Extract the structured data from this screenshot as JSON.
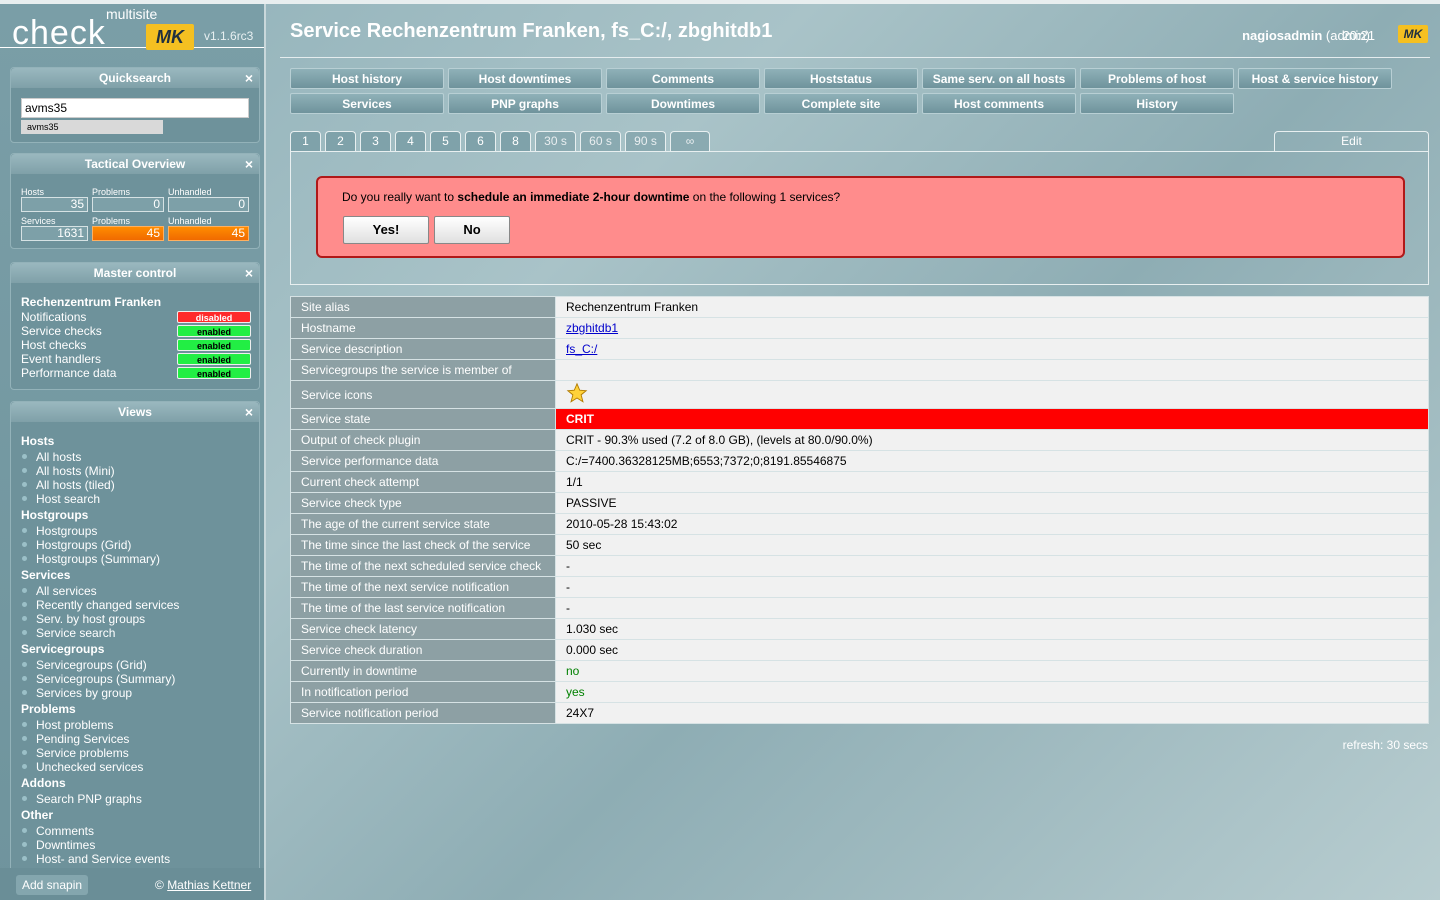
{
  "logo": {
    "multisite": "multisite",
    "check": "check",
    "mk": "MK",
    "version": "v1.1.6rc3"
  },
  "quicksearch": {
    "title": "Quicksearch",
    "value": "avms35",
    "suggestion": "avms35",
    "close": "×"
  },
  "tactical": {
    "title": "Tactical Overview",
    "close": "×",
    "hosts_label": "Hosts",
    "problems_label": "Problems",
    "unhandled_label": "Unhandled",
    "services_label": "Services",
    "hosts": "35",
    "host_problems": "0",
    "host_unhandled": "0",
    "services": "1631",
    "service_problems": "45",
    "service_unhandled": "45"
  },
  "master_control": {
    "title": "Master control",
    "close": "×",
    "site": "Rechenzentrum Franken",
    "rows": [
      {
        "label": "Notifications",
        "state": "disabled"
      },
      {
        "label": "Service checks",
        "state": "enabled"
      },
      {
        "label": "Host checks",
        "state": "enabled"
      },
      {
        "label": "Event handlers",
        "state": "enabled"
      },
      {
        "label": "Performance data",
        "state": "enabled"
      }
    ]
  },
  "views": {
    "title": "Views",
    "close": "×",
    "groups": [
      {
        "name": "Hosts",
        "items": [
          "All hosts",
          "All hosts (Mini)",
          "All hosts (tiled)",
          "Host search"
        ]
      },
      {
        "name": "Hostgroups",
        "items": [
          "Hostgroups",
          "Hostgroups (Grid)",
          "Hostgroups (Summary)"
        ]
      },
      {
        "name": "Services",
        "items": [
          "All services",
          "Recently changed services",
          "Serv. by host groups",
          "Service search"
        ]
      },
      {
        "name": "Servicegroups",
        "items": [
          "Servicegroups (Grid)",
          "Servicegroups (Summary)",
          "Services by group"
        ]
      },
      {
        "name": "Problems",
        "items": [
          "Host problems",
          "Pending Services",
          "Service problems",
          "Unchecked services"
        ]
      },
      {
        "name": "Addons",
        "items": [
          "Search PNP graphs"
        ]
      },
      {
        "name": "Other",
        "items": [
          "Comments",
          "Downtimes",
          "Host- and Service events"
        ]
      }
    ]
  },
  "footer": {
    "add_snapin": "Add snapin",
    "copyright_prefix": "©",
    "author": "Mathias Kettner"
  },
  "header": {
    "title": "Service Rechenzentrum Franken, fs_C:/, zbghitdb1",
    "user": "nagiosadmin",
    "role": "(admin)",
    "time": "20:21",
    "mk": "MK"
  },
  "context_buttons": {
    "row1": [
      "Host history",
      "Host downtimes",
      "Comments",
      "Hoststatus",
      "Same serv. on all hosts",
      "Problems of host",
      "Host & service history"
    ],
    "row2": [
      "Services",
      "PNP graphs",
      "Downtimes",
      "Complete site",
      "Host comments",
      "History"
    ]
  },
  "tabs": [
    "1",
    "2",
    "3",
    "4",
    "5",
    "6",
    "8",
    "30 s",
    "60 s",
    "90 s",
    "∞"
  ],
  "edit_tab": "Edit",
  "confirm": {
    "prefix": "Do you really want to ",
    "bold": "schedule an immediate 2-hour downtime",
    "suffix": " on the following 1 services?",
    "yes": "Yes!",
    "no": "No"
  },
  "info_rows": [
    {
      "label": "Site alias",
      "value": "Rechenzentrum Franken"
    },
    {
      "label": "Hostname",
      "value": "zbghitdb1",
      "link": true
    },
    {
      "label": "Service description",
      "value": "fs_C:/",
      "link": true
    },
    {
      "label": "Servicegroups the service is member of",
      "value": ""
    },
    {
      "label": "Service icons",
      "value": "",
      "icon": "star-icon"
    },
    {
      "label": "Service state",
      "value": "CRIT",
      "state": "crit"
    },
    {
      "label": "Output of check plugin",
      "value": "CRIT - 90.3% used (7.2 of 8.0 GB), (levels at 80.0/90.0%)"
    },
    {
      "label": "Service performance data",
      "value": "C:/=7400.36328125MB;6553;7372;0;8191.85546875"
    },
    {
      "label": "Current check attempt",
      "value": "1/1"
    },
    {
      "label": "Service check type",
      "value": "PASSIVE"
    },
    {
      "label": "The age of the current service state",
      "value": "2010-05-28 15:43:02"
    },
    {
      "label": "The time since the last check of the service",
      "value": "50 sec"
    },
    {
      "label": "The time of the next scheduled service check",
      "value": "-"
    },
    {
      "label": "The time of the next service notification",
      "value": "-"
    },
    {
      "label": "The time of the last service notification",
      "value": "-"
    },
    {
      "label": "Service check latency",
      "value": "1.030 sec"
    },
    {
      "label": "Service check duration",
      "value": "0.000 sec"
    },
    {
      "label": "Currently in downtime",
      "value": "no",
      "state": "green"
    },
    {
      "label": "In notification period",
      "value": "yes",
      "state": "green"
    },
    {
      "label": "Service notification period",
      "value": "24X7"
    }
  ],
  "refresh": "refresh: 30 secs",
  "colors": {
    "crit": "#ff0000",
    "ok_green": "#008000",
    "enabled": "#22ee44",
    "disabled": "#ff2a2a",
    "warn_orange": "#ff8c00",
    "confirm_bg": "#ff8c8c"
  }
}
